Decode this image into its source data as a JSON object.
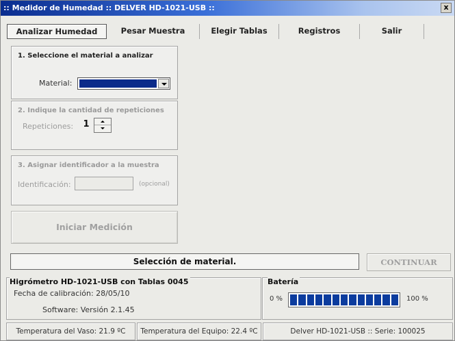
{
  "window": {
    "title": ":: Medidor de Humedad :: DELVER HD-1021-USB ::",
    "close_label": "x"
  },
  "tabs": [
    {
      "label": "Analizar Humedad",
      "active": true
    },
    {
      "label": "Pesar Muestra",
      "active": false
    },
    {
      "label": "Elegir Tablas",
      "active": false
    },
    {
      "label": "Registros",
      "active": false
    },
    {
      "label": "Salir",
      "active": false
    }
  ],
  "step1": {
    "title": "1. Seleccione el material a analizar",
    "material_label": "Material:",
    "material_value": ""
  },
  "step2": {
    "title": "2. Indique la cantidad de repeticiones",
    "repeticiones_label": "Repeticiones:",
    "repeticiones_value": "1"
  },
  "step3": {
    "title": "3. Asignar identificador a la muestra",
    "id_label": "Identificación:",
    "id_value": "",
    "optional_note": "(opcional)"
  },
  "actions": {
    "start_label": "Iniciar Medición",
    "continue_label": "CONTINUAR"
  },
  "status": {
    "message": "Selección de material."
  },
  "device": {
    "title": "Higrómetro HD-1021-USB con Tablas  0045",
    "calibration": "Fecha de calibración: 28/05/10",
    "software": "Software: Versión 2.1.45"
  },
  "battery": {
    "title": "Batería",
    "min_label": "0 %",
    "max_label": "100 %",
    "level": 1.0,
    "color": "#0c3c9e"
  },
  "footer": {
    "vessel_temp": "Temperatura del Vaso: 21.9 ºC",
    "device_temp": "Temperatura del Equipo: 22.4 ºC",
    "serial": "Delver HD-1021-USB :: Serie: 100025"
  }
}
